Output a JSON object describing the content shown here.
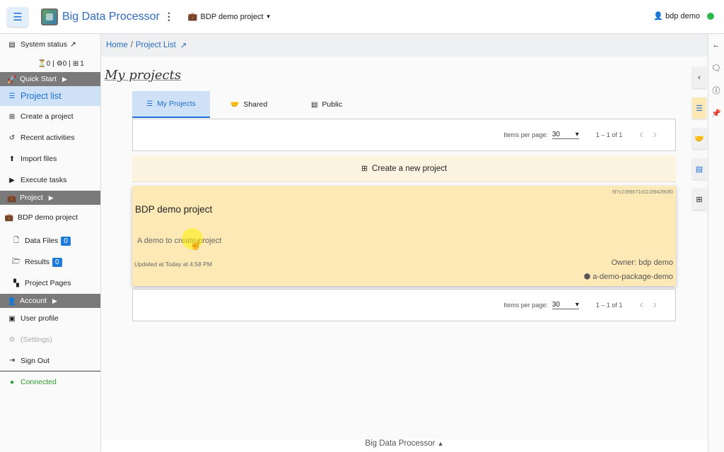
{
  "header": {
    "menu_icon": "hamburger-icon",
    "app_title": "Big Data Processor",
    "kebab": "⋮",
    "project_switch": "BDP demo project",
    "user_name": "bdp demo",
    "status_color": "#2db84d"
  },
  "sidebar": {
    "system_status": "System status",
    "counts": {
      "tasks": "0",
      "jobs": "0",
      "nodes": "1"
    },
    "quick_start": "Quick Start",
    "project_list": "Project list",
    "create_project": "Create a project",
    "recent_activities": "Recent activities",
    "import_files": "Import files",
    "execute_tasks": "Execute tasks",
    "project_section": "Project",
    "current_project": "BDP demo project",
    "data_files": "Data Files",
    "data_files_count": "0",
    "results": "Results",
    "results_count": "0",
    "project_pages": "Project Pages",
    "account_section": "Account",
    "user_profile": "User profile",
    "settings": "(Settings)",
    "sign_out": "Sign Out",
    "connected": "Connected"
  },
  "breadcrumb": {
    "home": "Home",
    "separator": "/",
    "current": "Project List"
  },
  "main": {
    "title": "My projects",
    "tabs": [
      {
        "label": "My Projects",
        "icon": "list-icon"
      },
      {
        "label": "Shared",
        "icon": "handshake-icon"
      },
      {
        "label": "Public",
        "icon": "table-icon"
      }
    ],
    "pager": {
      "items_per_page_label": "Items per page:",
      "items_per_page": "30",
      "range": "1 – 1 of 1"
    },
    "create_new": "Create a new project",
    "project": {
      "id": "5f7c2399071d1118942f83f0",
      "name": "BDP demo project",
      "description": "A demo to create project",
      "updated": "Updated at Today at 4:58 PM",
      "owner": "Owner: bdp demo",
      "package": "a-demo-package-demo"
    }
  },
  "footer": {
    "label": "Big Data Processor"
  },
  "colors": {
    "accent": "#1e6fd9",
    "card": "#fde9b5",
    "create_bg": "#fdf3e1"
  }
}
